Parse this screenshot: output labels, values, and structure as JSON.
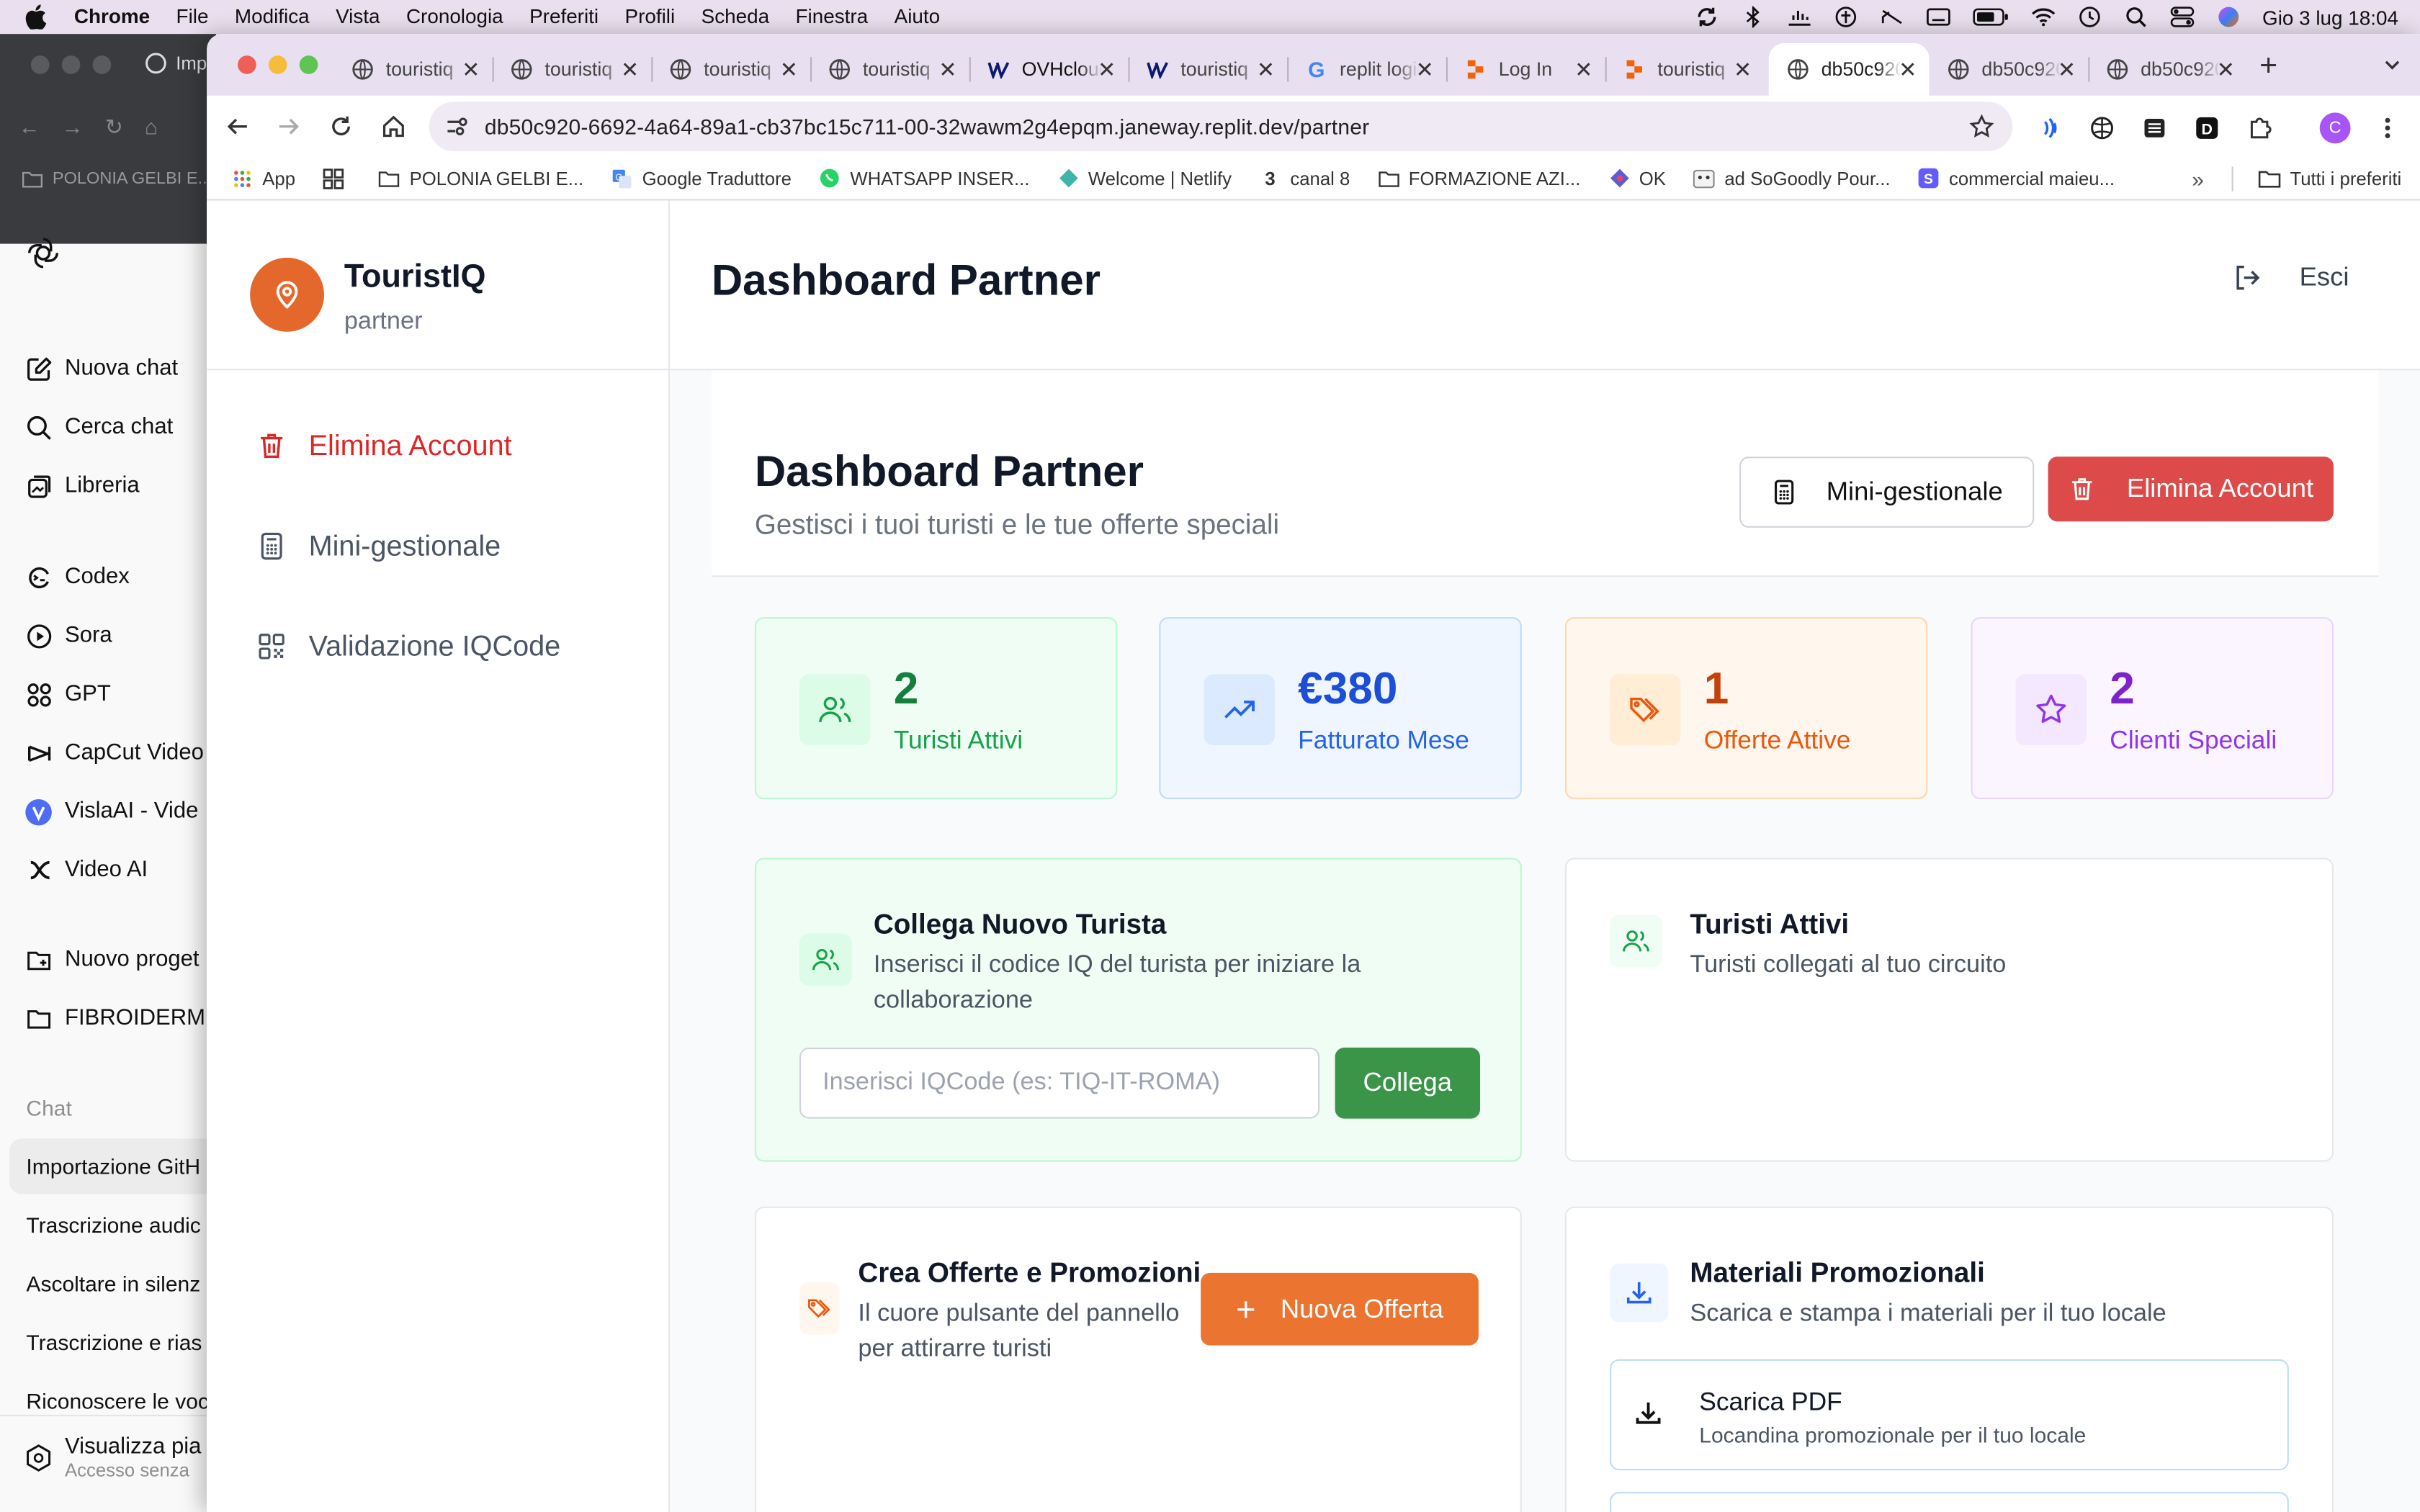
{
  "menubar": {
    "app": "Chrome",
    "items": [
      "File",
      "Modifica",
      "Vista",
      "Cronologia",
      "Preferiti",
      "Profili",
      "Scheda",
      "Finestra",
      "Aiuto"
    ],
    "clock": "Gio 3 lug  18:04"
  },
  "background_app": {
    "tab_label": "Imp",
    "bookmark": "POLONIA GELBI E...",
    "nav": [
      {
        "label": "Nuova chat",
        "icon": "edit-icon"
      },
      {
        "label": "Cerca chat",
        "icon": "search-icon"
      },
      {
        "label": "Libreria",
        "icon": "library-icon"
      },
      {
        "label": "Codex",
        "icon": "codex-icon"
      },
      {
        "label": "Sora",
        "icon": "play-icon"
      },
      {
        "label": "GPT",
        "icon": "grid-icon"
      },
      {
        "label": "CapCut Video",
        "icon": "capcut-icon"
      },
      {
        "label": "VislaAI - Vide",
        "icon": "visla-icon"
      },
      {
        "label": "Video AI",
        "icon": "video-ai-icon"
      },
      {
        "label": "Nuovo proget",
        "icon": "new-folder-icon"
      },
      {
        "label": "FIBROIDERM I",
        "icon": "folder-icon"
      }
    ],
    "section_label": "Chat",
    "chats": [
      "Importazione GitH",
      "Trascrizione audic",
      "Ascoltare in silenz",
      "Trascrizione e rias",
      "Riconoscere le voc"
    ],
    "upgrade_title": "Visualizza pia",
    "upgrade_sub": "Accesso senza"
  },
  "browser": {
    "tabs": [
      {
        "title": "touristiq",
        "icon": "globe-icon"
      },
      {
        "title": "touristiq",
        "icon": "globe-icon"
      },
      {
        "title": "touristiq",
        "icon": "globe-icon"
      },
      {
        "title": "touristiq",
        "icon": "globe-icon"
      },
      {
        "title": "OVHcloud",
        "icon": "ovh-icon"
      },
      {
        "title": "touristiq",
        "icon": "ovh-icon"
      },
      {
        "title": "replit login",
        "icon": "google-icon"
      },
      {
        "title": "Log In",
        "icon": "replit-icon"
      },
      {
        "title": "touristiq",
        "icon": "replit-icon"
      },
      {
        "title": "db50c920",
        "icon": "globe-icon",
        "active": true
      },
      {
        "title": "db50c920",
        "icon": "globe-icon"
      },
      {
        "title": "db50c920",
        "icon": "globe-icon"
      }
    ],
    "url": "db50c920-6692-4a64-89a1-cb37bc15c711-00-32wawm2g4epqm.janeway.replit.dev/partner",
    "profile_initial": "C",
    "bookmarks": [
      {
        "label": "App",
        "icon": "apps-grid-icon"
      },
      {
        "label": "",
        "icon": "tab-groups-icon"
      },
      {
        "label": "POLONIA GELBI E...",
        "icon": "folder-icon"
      },
      {
        "label": "Google Traduttore",
        "icon": "translate-icon"
      },
      {
        "label": "WHATSAPP INSER...",
        "icon": "whatsapp-icon"
      },
      {
        "label": "Welcome | Netlify",
        "icon": "netlify-icon"
      },
      {
        "label": "canal 8",
        "icon": "canal8-icon"
      },
      {
        "label": "FORMAZIONE AZI...",
        "icon": "folder-icon"
      },
      {
        "label": "OK",
        "icon": "ok-icon"
      },
      {
        "label": "ad SoGoodly Pour...",
        "icon": "sogoodly-icon"
      },
      {
        "label": "commercial maieu...",
        "icon": "s-icon"
      }
    ],
    "bookmarks_all": "Tutti i preferiti"
  },
  "app": {
    "brand": "TouristIQ",
    "role": "partner",
    "sidebar": [
      {
        "label": "Elimina Account",
        "icon": "trash-icon",
        "color": "#dc2626"
      },
      {
        "label": "Mini-gestionale",
        "icon": "calculator-icon",
        "color": "#4b5563"
      },
      {
        "label": "Validazione IQCode",
        "icon": "qr-code-icon",
        "color": "#4b5563"
      }
    ],
    "page_title": "Dashboard Partner",
    "logout": "Esci",
    "header": {
      "title": "Dashboard Partner",
      "subtitle": "Gestisci i tuoi turisti e le tue offerte speciali",
      "mini_button": "Mini-gestionale",
      "delete_button": "Elimina Account"
    },
    "stats": [
      {
        "value": "2",
        "label": "Turisti Attivi",
        "icon": "users-icon",
        "color": "#16803c"
      },
      {
        "value": "€380",
        "label": "Fatturato Mese",
        "icon": "trending-up-icon",
        "color": "#1d4ed8"
      },
      {
        "value": "1",
        "label": "Offerte Attive",
        "icon": "tags-icon",
        "color": "#c2410c"
      },
      {
        "value": "2",
        "label": "Clienti Speciali",
        "icon": "star-icon",
        "color": "#7e22ce"
      }
    ],
    "connect": {
      "title": "Collega Nuovo Turista",
      "subtitle": "Inserisci il codice IQ del turista per iniziare la collaborazione",
      "placeholder": "Inserisci IQCode (es: TIQ-IT-ROMA)",
      "button": "Collega"
    },
    "active_tourists": {
      "title": "Turisti Attivi",
      "subtitle": "Turisti collegati al tuo circuito"
    },
    "offers": {
      "title": "Crea Offerte e Promozioni",
      "subtitle": "Il cuore pulsante del pannello per attirarre turisti",
      "button": "Nuova Offerta"
    },
    "materials": {
      "title": "Materiali Promozionali",
      "subtitle": "Scarica e stampa i materiali per il tuo locale",
      "pdf_title": "Scarica PDF",
      "pdf_subtitle": "Locandina promozionale per il tuo locale"
    }
  }
}
